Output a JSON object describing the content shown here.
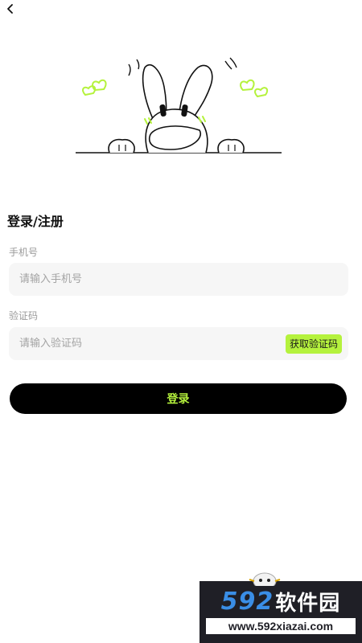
{
  "nav": {
    "back_icon": "chevron-left-icon"
  },
  "illustration": {
    "name": "bunny-peeking-illustration",
    "accent_color": "#b5f23d"
  },
  "page_title": "登录/注册",
  "phone": {
    "label": "手机号",
    "placeholder": "请输入手机号",
    "value": ""
  },
  "code": {
    "label": "验证码",
    "placeholder": "请输入验证码",
    "value": "",
    "get_code_label": "获取验证码"
  },
  "login_button": "登录",
  "colors": {
    "accent": "#b5f23d",
    "button_bg": "#000000",
    "input_bg": "#f6f6f6",
    "label": "#9a9a9a"
  },
  "watermark": {
    "brand_num": "592",
    "brand_cn": "软件园",
    "url": "www.592xiazai.com"
  }
}
